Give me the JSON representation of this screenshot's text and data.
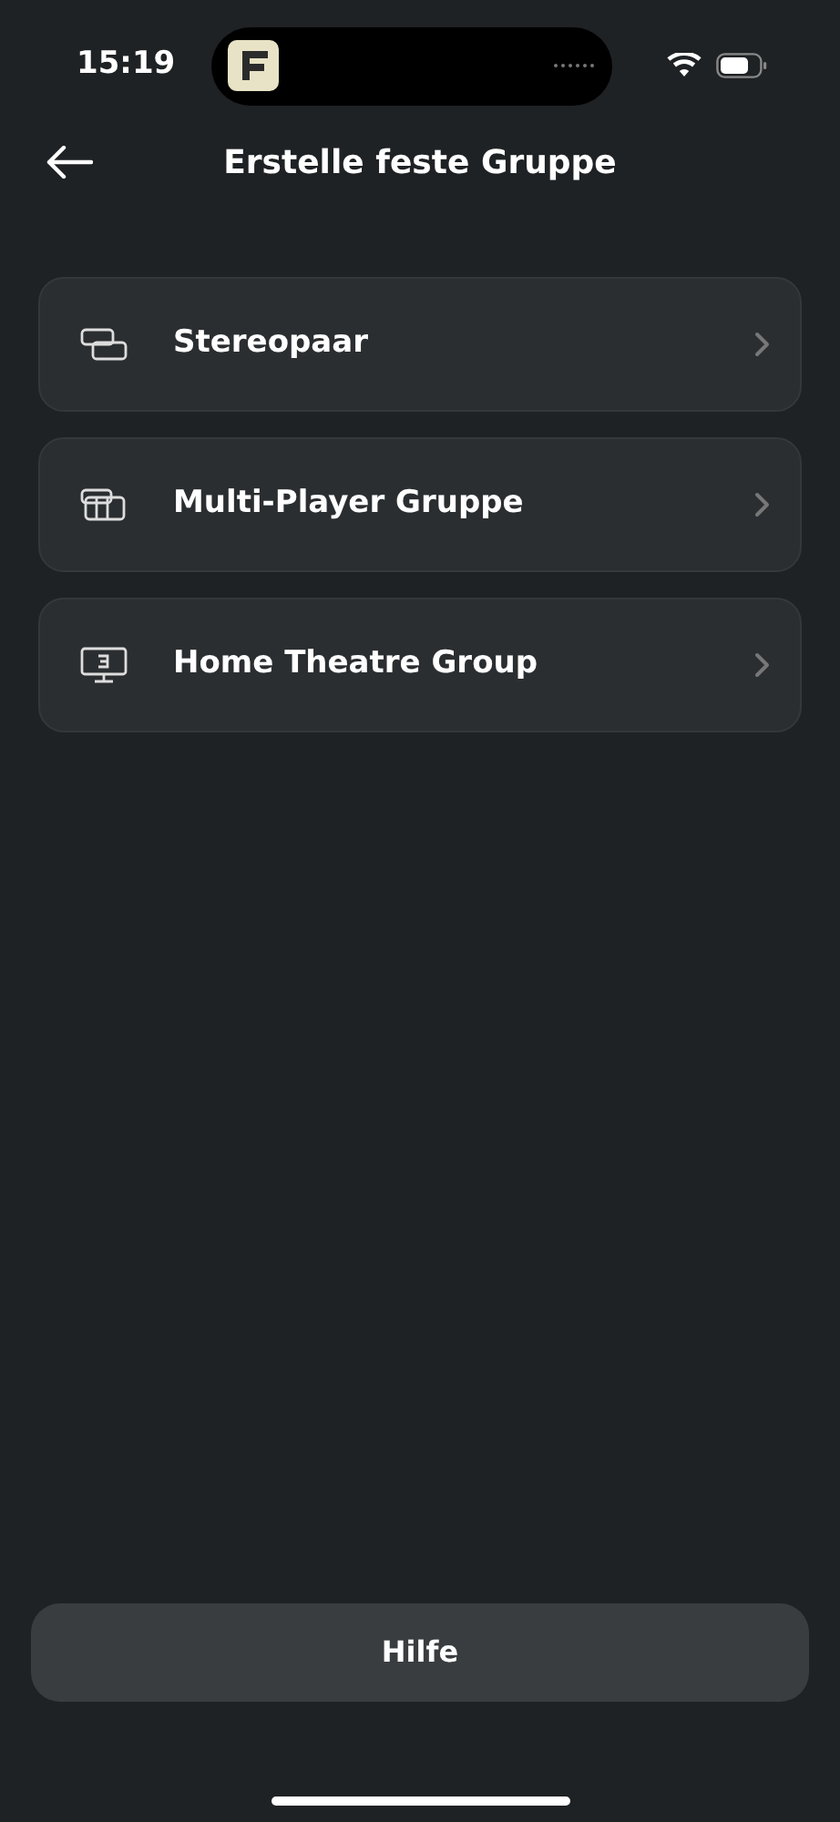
{
  "status_bar": {
    "time": "15:19"
  },
  "header": {
    "title": "Erstelle feste Gruppe"
  },
  "options": [
    {
      "kind": "pair",
      "label": "Stereopaar"
    },
    {
      "kind": "multi",
      "label": "Multi-Player Gruppe"
    },
    {
      "kind": "theatre",
      "label": "Home Theatre Group"
    }
  ],
  "help_button": {
    "label": "Hilfe"
  }
}
